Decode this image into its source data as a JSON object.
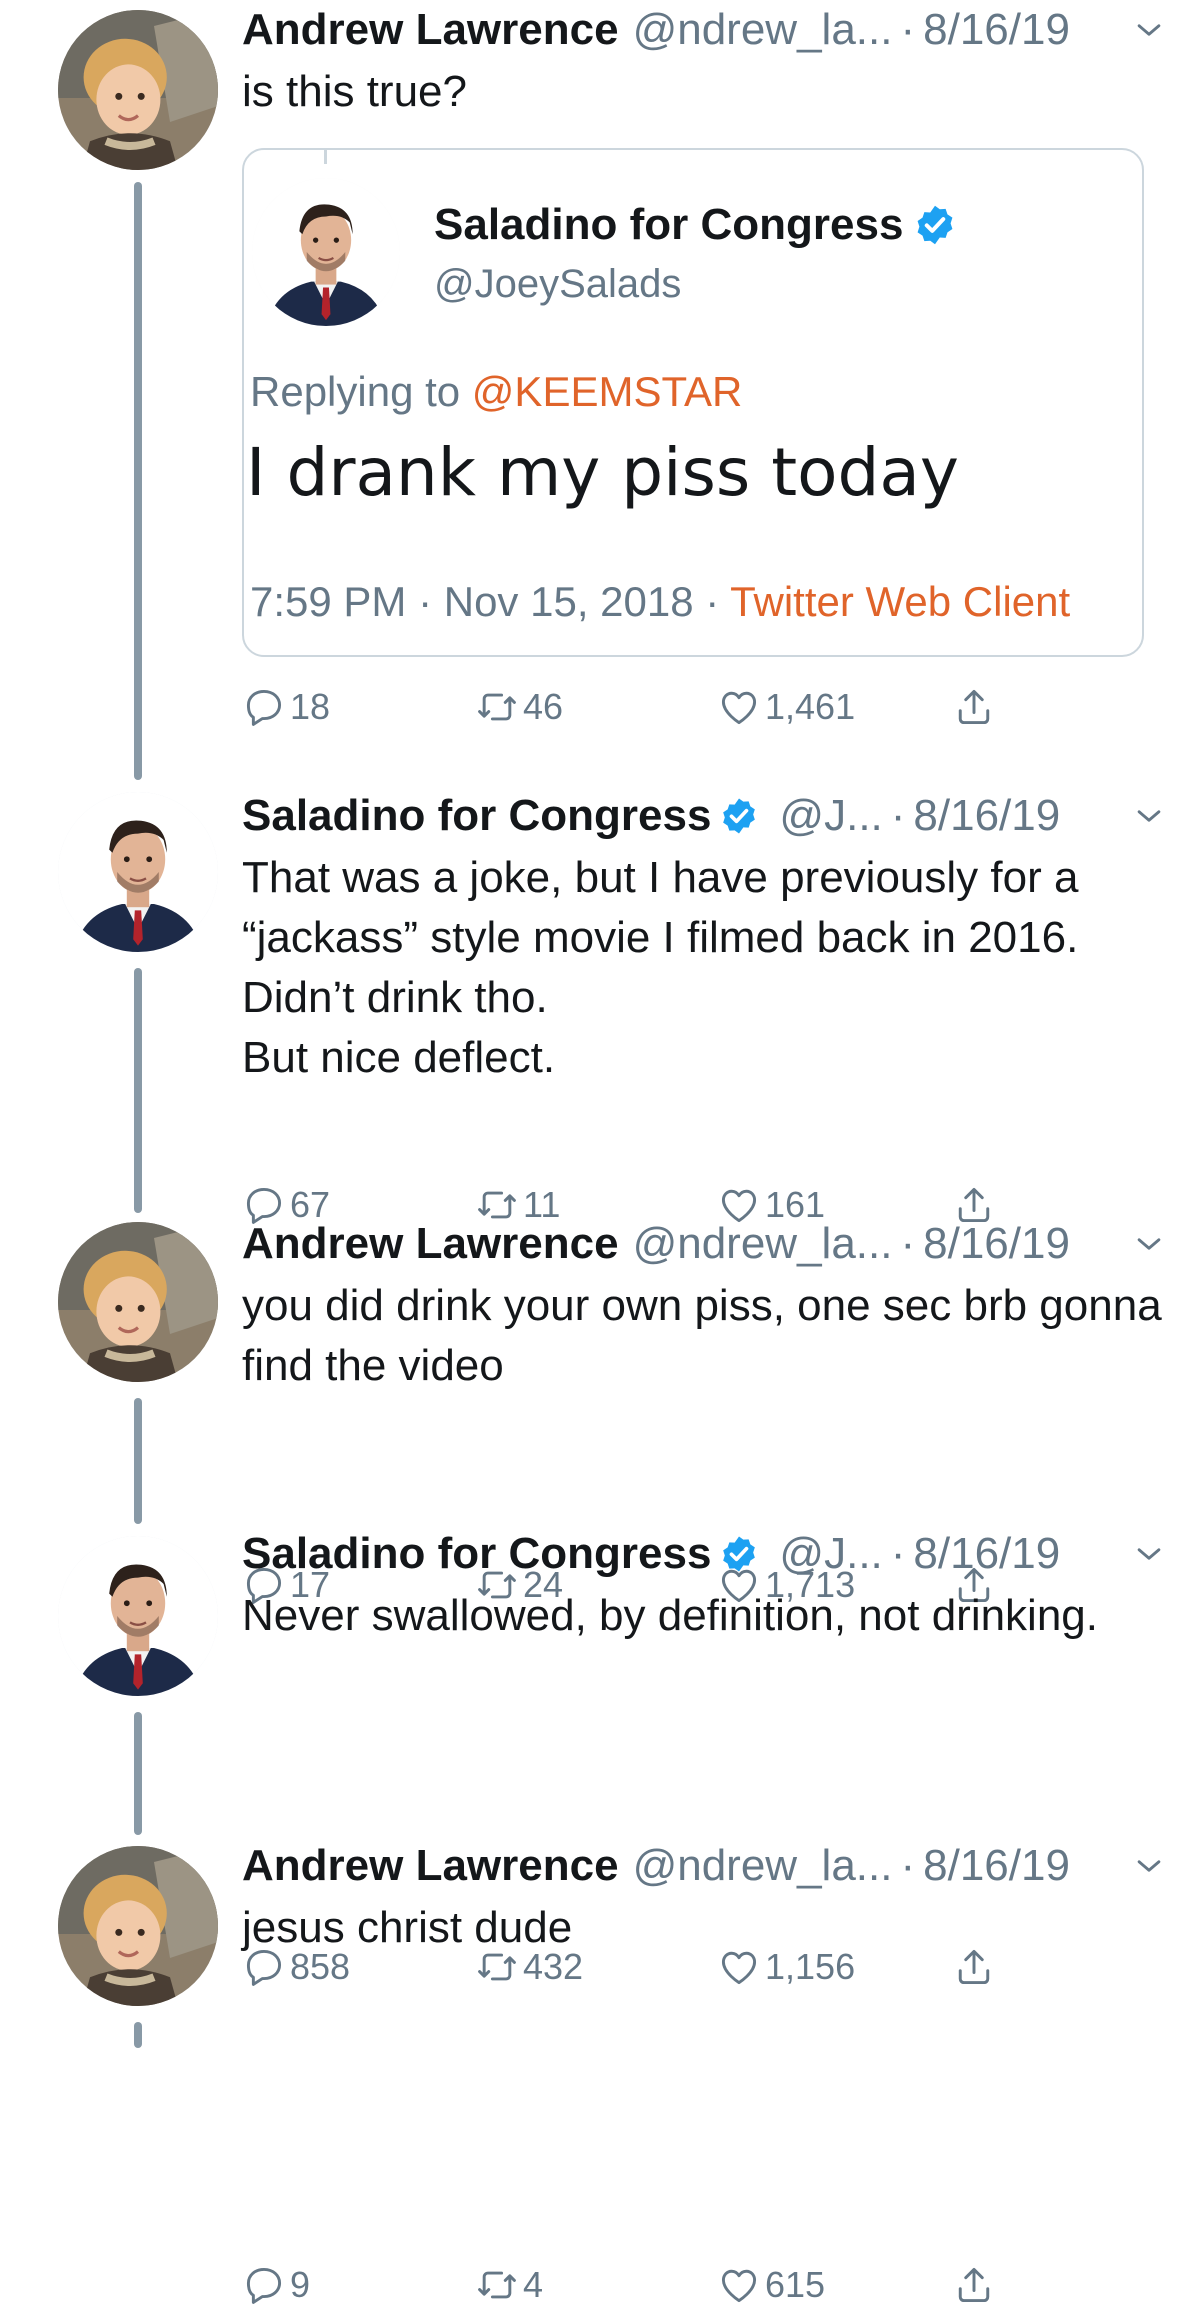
{
  "tweets": [
    {
      "name": "Andrew Lawrence",
      "handle": "@ndrew_la...",
      "separator": "·",
      "date": "8/16/19",
      "verified": false,
      "text": [
        "is this true?"
      ],
      "counts": {
        "replies": "18",
        "retweets": "46",
        "likes": "1,461"
      },
      "quote": {
        "name": "Saladino for Congress",
        "handle": "@JoeySalads",
        "replying_prefix": "Replying to",
        "replying_to": "@KEEMSTAR",
        "text": "I drank my piss today",
        "timestamp": "7:59 PM · Nov 15, 2018 ·",
        "client": "Twitter Web Client"
      }
    },
    {
      "name": "Saladino for Congress",
      "handle": "@J...",
      "separator": "·",
      "date": "8/16/19",
      "verified": true,
      "text": [
        "That was a joke, but I have previously for a “jackass” style movie I filmed back in 2016. Didn’t drink tho.",
        "But nice deflect."
      ],
      "counts": {
        "replies": "67",
        "retweets": "11",
        "likes": "161"
      }
    },
    {
      "name": "Andrew Lawrence",
      "handle": "@ndrew_la...",
      "separator": "·",
      "date": "8/16/19",
      "verified": false,
      "text": [
        "you did drink your own piss, one sec brb gonna find the video"
      ],
      "counts": {
        "replies": "17",
        "retweets": "24",
        "likes": "1,713"
      }
    },
    {
      "name": "Saladino for Congress",
      "handle": "@J...",
      "separator": "·",
      "date": "8/16/19",
      "verified": true,
      "text": [
        "Never swallowed, by definition, not drinking."
      ],
      "counts": {
        "replies": "858",
        "retweets": "432",
        "likes": "1,156"
      }
    },
    {
      "name": "Andrew Lawrence",
      "handle": "@ndrew_la...",
      "separator": "·",
      "date": "8/16/19",
      "verified": false,
      "text": [
        "jesus christ dude"
      ],
      "counts": {
        "replies": "9",
        "retweets": "4",
        "likes": "615"
      }
    }
  ],
  "colors": {
    "text": "#14171a",
    "muted": "#657786",
    "verified": "#1da1f2",
    "link": "#e0642a",
    "thread_line": "#8899a6",
    "border": "#ccd6dd"
  },
  "icons": {
    "reply": "reply-icon",
    "retweet": "retweet-icon",
    "like": "heart-icon",
    "share": "share-icon",
    "caret": "chevron-down-icon",
    "verified": "verified-badge-icon"
  }
}
